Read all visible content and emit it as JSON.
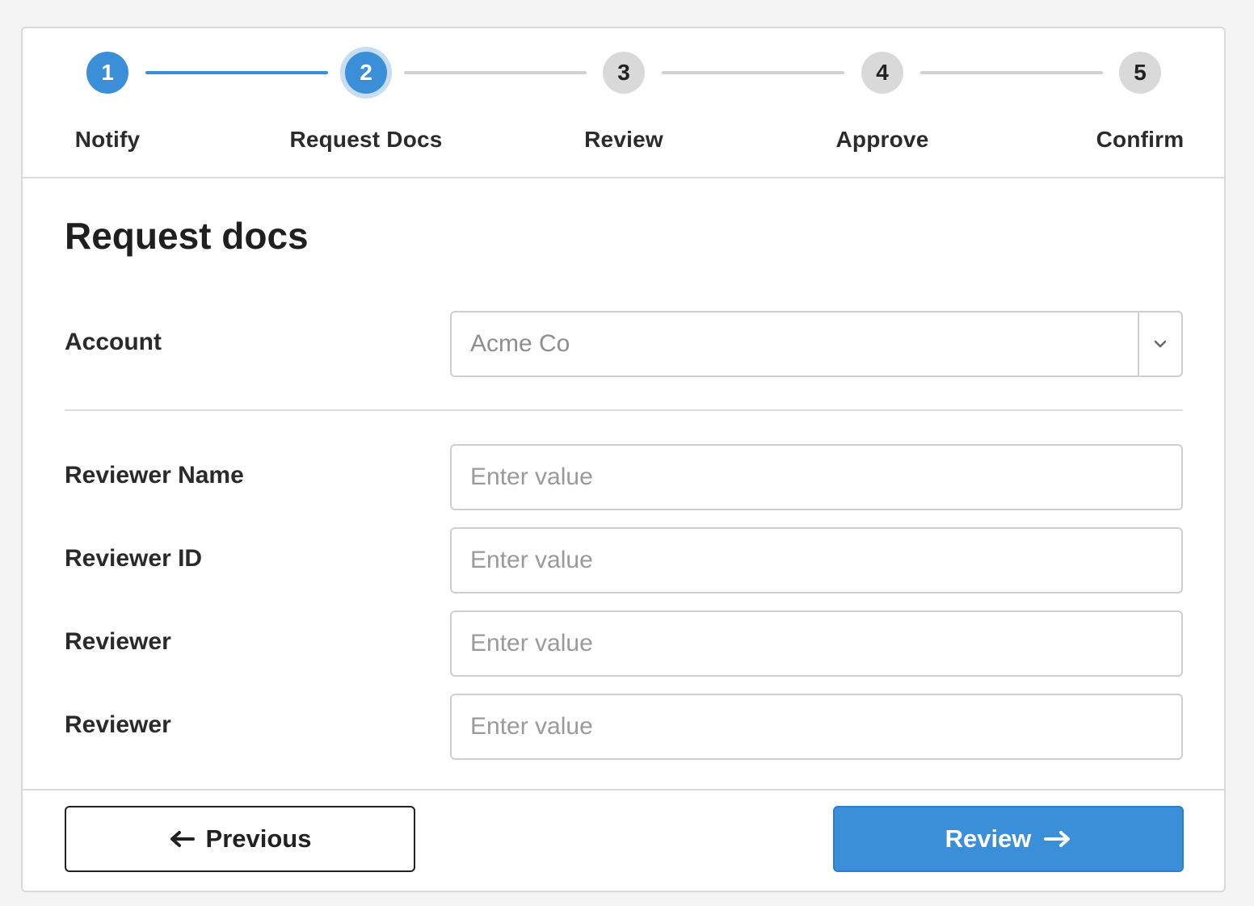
{
  "stepper": {
    "steps": [
      {
        "number": "1",
        "label": "Notify",
        "state": "done"
      },
      {
        "number": "2",
        "label": "Request Docs",
        "state": "active"
      },
      {
        "number": "3",
        "label": "Review",
        "state": "pending"
      },
      {
        "number": "4",
        "label": "Approve",
        "state": "pending"
      },
      {
        "number": "5",
        "label": "Confirm",
        "state": "pending"
      }
    ]
  },
  "form": {
    "title": "Request docs",
    "account": {
      "label": "Account",
      "value": "Acme Co"
    },
    "fields": [
      {
        "label": "Reviewer Name",
        "placeholder": "Enter value",
        "value": ""
      },
      {
        "label": "Reviewer ID",
        "placeholder": "Enter value",
        "value": ""
      },
      {
        "label": "Reviewer",
        "placeholder": "Enter value",
        "value": ""
      },
      {
        "label": "Reviewer",
        "placeholder": "Enter value",
        "value": ""
      }
    ]
  },
  "footer": {
    "previous_label": "Previous",
    "next_label": "Review"
  },
  "colors": {
    "accent": "#3b8fd9",
    "pending": "#d9d9d9"
  },
  "icons": {
    "account_dropdown": "chevron-down-icon",
    "previous": "arrow-left-icon",
    "next": "arrow-right-icon"
  }
}
